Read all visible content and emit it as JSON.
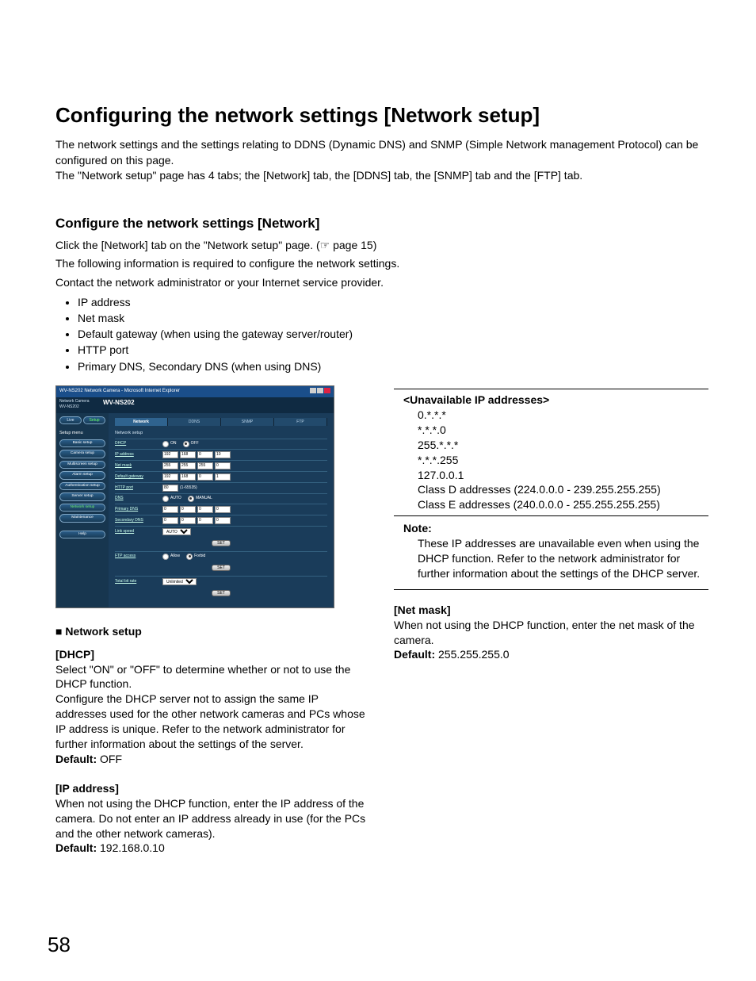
{
  "title": "Configuring the network settings [Network setup]",
  "intro1": "The network settings and the settings relating to DDNS (Dynamic DNS) and SNMP (Simple Network management Protocol) can be configured on this page.",
  "intro2": "The \"Network setup\" page has 4 tabs; the [Network] tab, the [DDNS] tab, the [SNMP] tab and the [FTP] tab.",
  "sub_title": "Configure the network settings [Network]",
  "sub_p1": "Click the [Network] tab on the \"Network setup\" page. (☞ page 15)",
  "sub_p2": "The following information is required to configure the network settings.",
  "sub_p3": "Contact the network administrator or your Internet service provider.",
  "reqs": [
    "IP address",
    "Net mask",
    "Default gateway (when using the gateway server/router)",
    "HTTP port",
    "Primary DNS, Secondary DNS (when using DNS)"
  ],
  "shot": {
    "window_title": "WV-NS202 Network Camera - Microsoft Internet Explorer",
    "model_small": "Network Camera",
    "model_sub": "WV-NS202",
    "model_big": "WV-NS202",
    "live": "Live",
    "setup": "Setup",
    "menu_header": "Setup menu",
    "menu": [
      "Basic setup",
      "Camera setup",
      "Multiscreen setup",
      "Alarm setup",
      "Authentication setup",
      "Server setup",
      "Network setup",
      "Maintenance",
      "Help"
    ],
    "menu_active_index": 6,
    "tabs": [
      "Network",
      "DDNS",
      "SNMP",
      "FTP"
    ],
    "tab_active_index": 0,
    "section1": "Network setup",
    "rows": {
      "dhcp": {
        "label": "DHCP",
        "on": "ON",
        "off": "OFF"
      },
      "ip": {
        "label": "IP address",
        "o1": "192",
        "o2": "168",
        "o3": "0",
        "o4": "10"
      },
      "mask": {
        "label": "Net mask",
        "o1": "255",
        "o2": "255",
        "o3": "255",
        "o4": "0"
      },
      "gw": {
        "label": "Default gateway",
        "o1": "192",
        "o2": "168",
        "o3": "0",
        "o4": "1"
      },
      "http": {
        "label": "HTTP port",
        "val": "80",
        "hint": "(1-65535)"
      },
      "dns": {
        "label": "DNS",
        "auto": "AUTO",
        "manual": "MANUAL"
      },
      "pdns": {
        "label": "Primary DNS",
        "o1": "0",
        "o2": "0",
        "o3": "0",
        "o4": "0"
      },
      "sdns": {
        "label": "Secondary DNS",
        "o1": "0",
        "o2": "0",
        "o3": "0",
        "o4": "0"
      },
      "link": {
        "label": "Link speed",
        "val": "AUTO"
      }
    },
    "set_btn": "SET",
    "ftp_label": "FTP access",
    "ftp_allow": "Allow",
    "ftp_forbid": "Forbid",
    "bw_label": "Total bit rate",
    "bw_val": "Unlimited"
  },
  "left": {
    "section_head": "■ Network setup",
    "dhcp_head": "[DHCP]",
    "dhcp_p1": "Select \"ON\" or \"OFF\" to determine whether or not to use the DHCP function.",
    "dhcp_p2": "Configure the DHCP server not to assign the same IP addresses used for the other network cameras and PCs whose IP address is unique. Refer to the network administrator for further information about the settings of the server.",
    "dhcp_def_label": "Default: ",
    "dhcp_def": "OFF",
    "ip_head": "[IP address]",
    "ip_p1": "When not using the DHCP function, enter the IP address of the camera. Do not enter an IP address already in use (for the PCs and the other network cameras).",
    "ip_def_label": "Default: ",
    "ip_def": "192.168.0.10"
  },
  "right": {
    "unavail_title": "<Unavailable IP addresses>",
    "unavail_list": [
      "0.*.*.*",
      "*.*.*.0",
      "255.*.*.*",
      "*.*.*.255",
      "127.0.0.1",
      "Class D addresses (224.0.0.0 - 239.255.255.255)",
      "Class E addresses (240.0.0.0 - 255.255.255.255)"
    ],
    "note_head": "Note:",
    "note_body": "These IP addresses are unavailable even when using the DHCP function. Refer to the network administrator for further information about the settings of the DHCP server.",
    "mask_head": "[Net mask]",
    "mask_p1": "When not using the DHCP function, enter the net mask of the camera.",
    "mask_def_label": "Default: ",
    "mask_def": "255.255.255.0"
  },
  "page_number": "58"
}
